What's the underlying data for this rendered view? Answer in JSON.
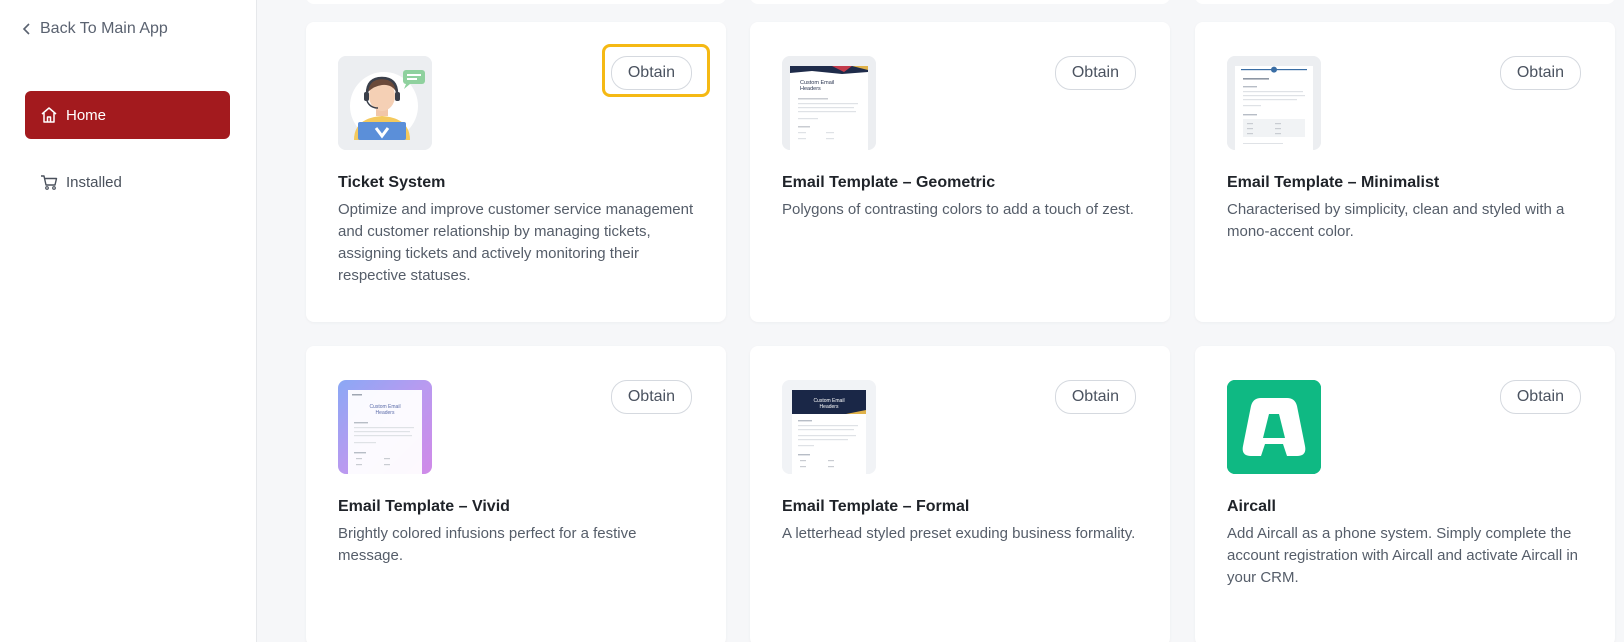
{
  "sidebar": {
    "back_label": "Back To Main App",
    "items": [
      {
        "label": "Home",
        "icon": "home-icon",
        "active": true
      },
      {
        "label": "Installed",
        "icon": "cart-icon",
        "active": false
      }
    ]
  },
  "colors": {
    "accent": "#a31a1e",
    "highlight": "#f5b914",
    "aircall_green": "#0fb983"
  },
  "apps": [
    {
      "title": "Ticket System",
      "description": "Optimize and improve customer service management and customer relationship by managing tickets, assigning tickets and actively monitoring their respective statuses.",
      "button": "Obtain",
      "thumb": "support-agent-icon"
    },
    {
      "title": "Email Template – Geometric",
      "description": "Polygons of contrasting colors to add a touch of zest.",
      "button": "Obtain",
      "thumb": "email-template-thumbnail"
    },
    {
      "title": "Email Template – Minimalist",
      "description": "Characterised by simplicity, clean and styled with a mono-accent color.",
      "button": "Obtain",
      "thumb": "email-template-thumbnail"
    },
    {
      "title": "Email Template – Vivid",
      "description": "Brightly colored infusions perfect for a festive message.",
      "button": "Obtain",
      "thumb": "email-template-thumbnail"
    },
    {
      "title": "Email Template – Formal",
      "description": "A letterhead styled preset exuding business formality.",
      "button": "Obtain",
      "thumb": "email-template-thumbnail"
    },
    {
      "title": "Aircall",
      "description": "Add Aircall as a phone system. Simply complete the account registration with Aircall and activate Aircall in your CRM.",
      "button": "Obtain",
      "thumb": "aircall-logo"
    }
  ],
  "thumb_text": {
    "email_header": "Custom Email Headers"
  }
}
